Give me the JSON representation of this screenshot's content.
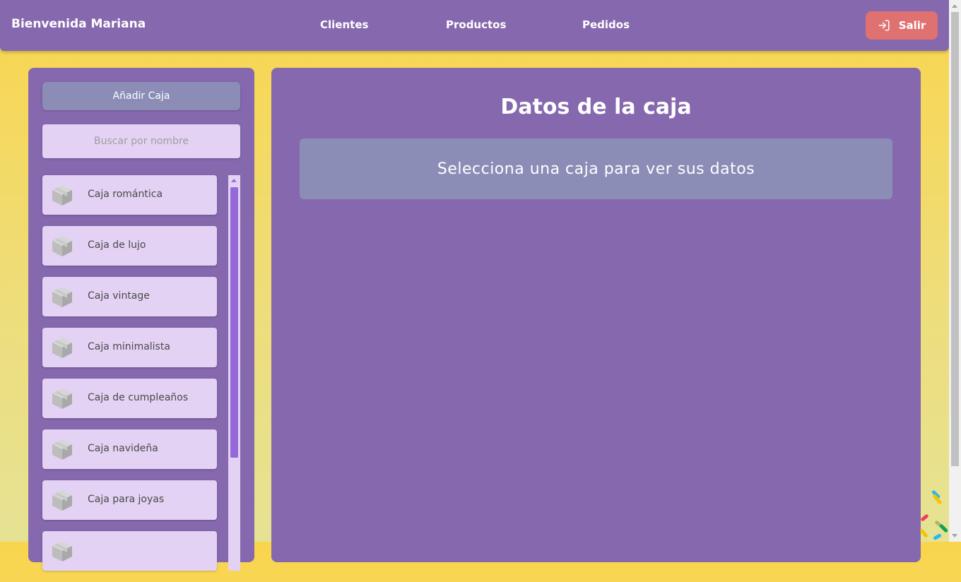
{
  "header": {
    "welcome": "Bienvenida Mariana",
    "nav": [
      {
        "label": "Clientes"
      },
      {
        "label": "Productos"
      },
      {
        "label": "Pedidos"
      }
    ],
    "exit_label": "Salir",
    "exit_icon": "sign-in-icon"
  },
  "sidebar": {
    "add_label": "Añadir Caja",
    "search_placeholder": "Buscar por nombre",
    "search_value": "",
    "boxes": [
      {
        "label": "Caja romántica",
        "icon": "box-icon"
      },
      {
        "label": "Caja de lujo",
        "icon": "box-icon"
      },
      {
        "label": "Caja vintage",
        "icon": "box-icon"
      },
      {
        "label": "Caja minimalista",
        "icon": "box-icon"
      },
      {
        "label": "Caja de cumpleaños",
        "icon": "box-icon"
      },
      {
        "label": "Caja navideña",
        "icon": "box-icon"
      },
      {
        "label": "Caja para joyas",
        "icon": "box-icon"
      },
      {
        "label": "",
        "icon": "box-icon"
      }
    ]
  },
  "main": {
    "title": "Datos de la caja",
    "message": "Selecciona una caja para ver sus datos"
  },
  "colors": {
    "primary": "#8668ae",
    "button": "#8b8db7",
    "item_bg": "#e3d2f3",
    "exit_button": "#e07171",
    "background_top": "#f9d54d",
    "background_bottom": "#e6e294"
  }
}
